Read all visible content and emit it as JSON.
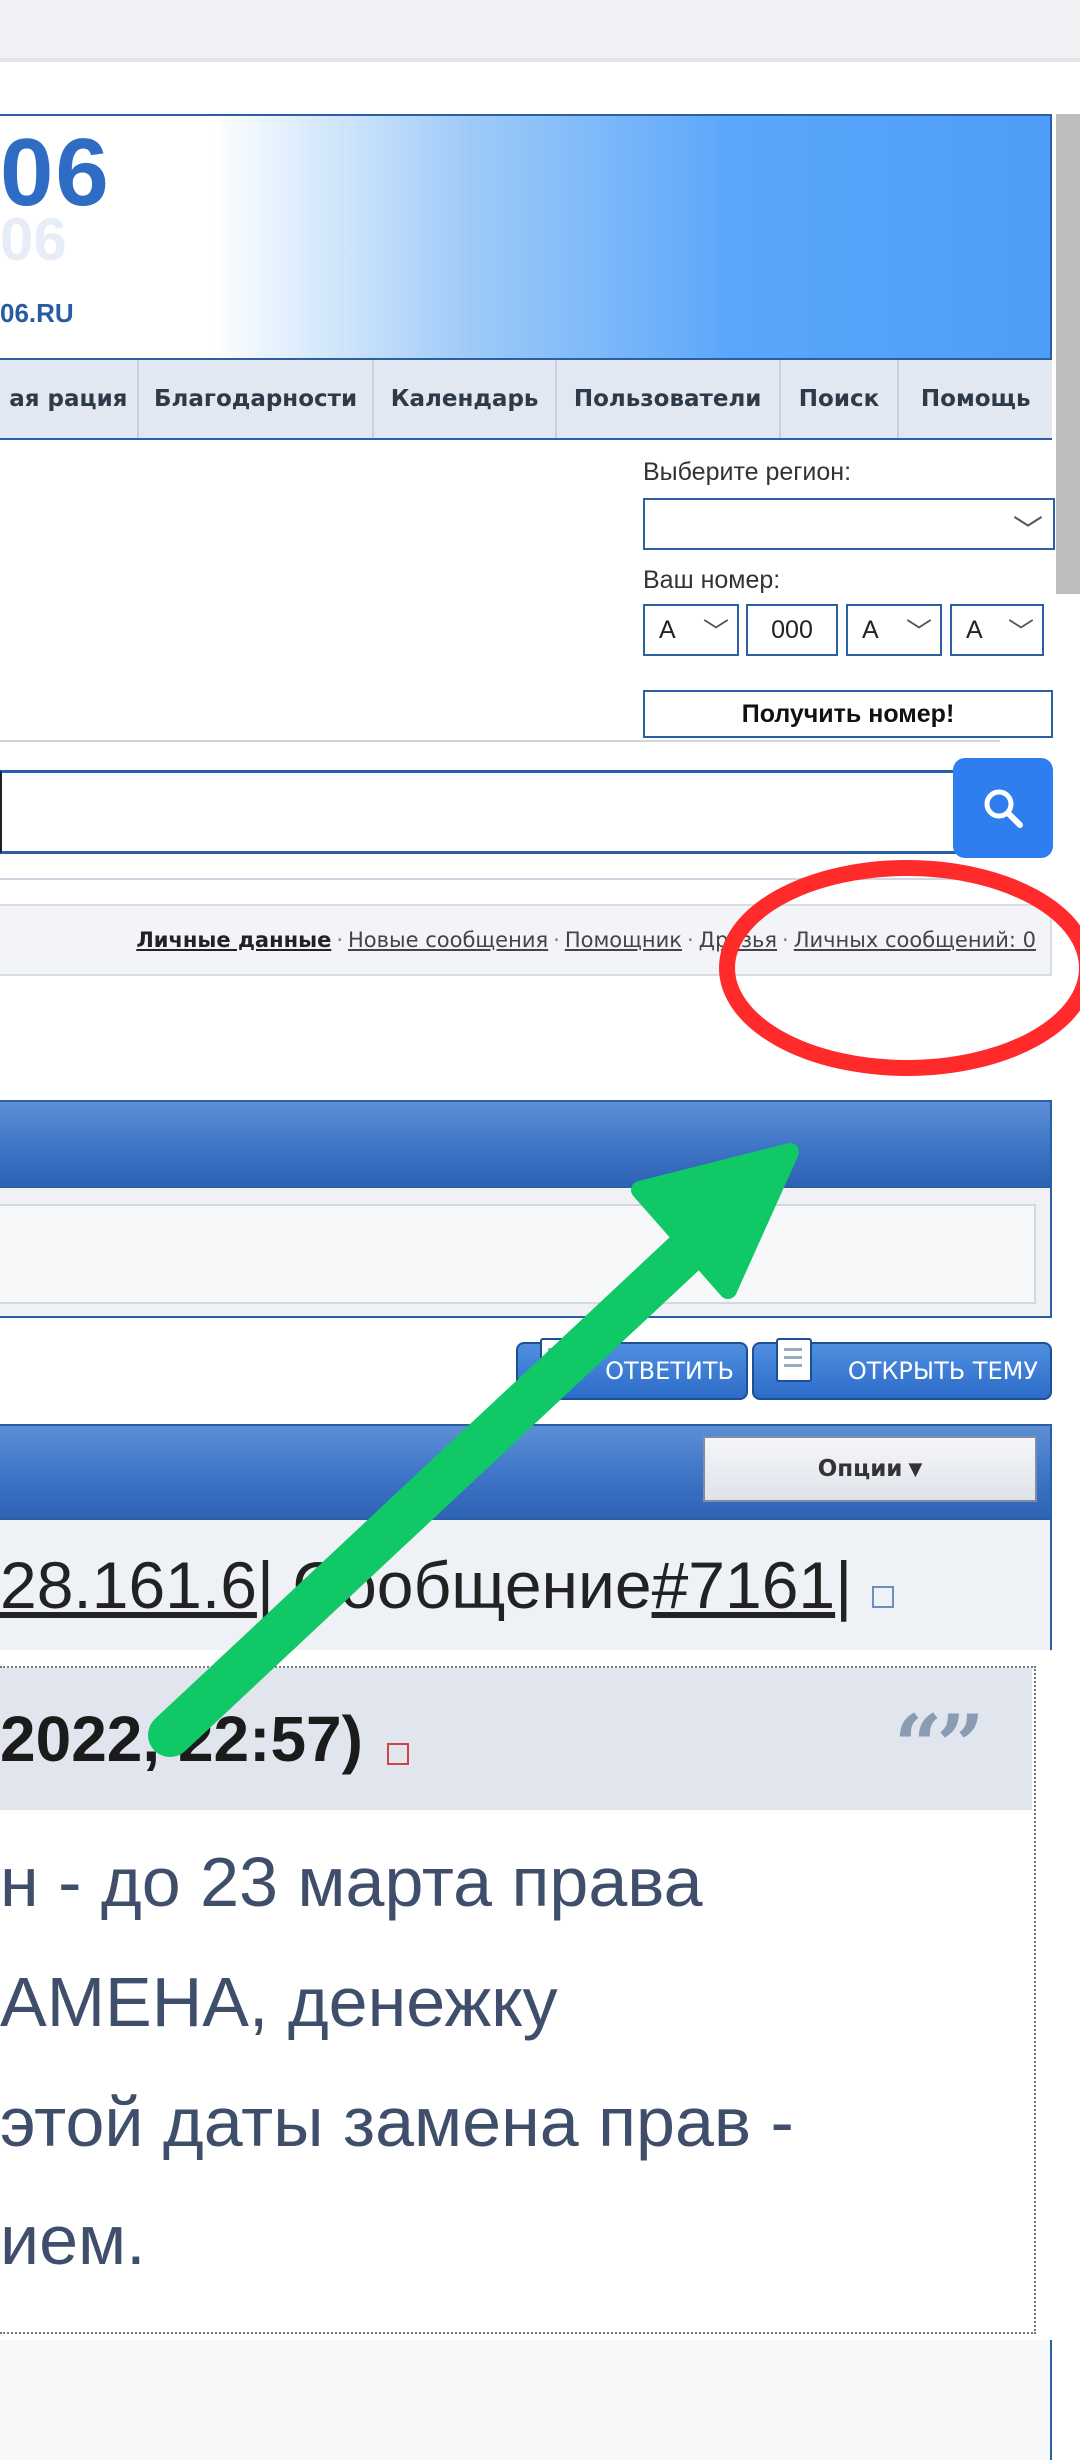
{
  "header": {
    "logo_number": "06",
    "logo_domain": "06.RU"
  },
  "nav": {
    "items": [
      "ая рация",
      "Благодарности",
      "Календарь",
      "Пользователи",
      "Поиск",
      "Помощь"
    ]
  },
  "plate": {
    "region_label": "Выберите регион:",
    "region_value": "",
    "number_label": "Ваш номер:",
    "letter1": "А",
    "digits": "000",
    "letter2": "А",
    "letter3": "А",
    "button_label": "Получить номер!"
  },
  "search": {
    "placeholder": "",
    "icon": "search-icon"
  },
  "userbar": {
    "personal": "Личные данные",
    "new_messages": "Новые сообщения",
    "helper": "Помощник",
    "friends": "Друзья",
    "pm": "Личных сообщений: 0",
    "separator": "·"
  },
  "actions": {
    "reply": "ОТВЕТИТЬ",
    "new_topic": "ОТКРЫТЬ ТЕМУ"
  },
  "post": {
    "options_label": "Опции",
    "ip_fragment": "28.161.6",
    "ip_sep": " | Сообщение ",
    "message_number": "#7161",
    "trailing_sep": " |",
    "quote_date": "2022, 22:57)",
    "quote_lines": [
      "н - до 23 марта права",
      "АМЕНА, денежку",
      "этой даты замена прав -",
      "ием."
    ]
  },
  "colors": {
    "accent_blue": "#2b5fa4",
    "search_button": "#2f7ef0",
    "annotation_circle": "#ff2a2a",
    "annotation_arrow": "#10c865"
  }
}
